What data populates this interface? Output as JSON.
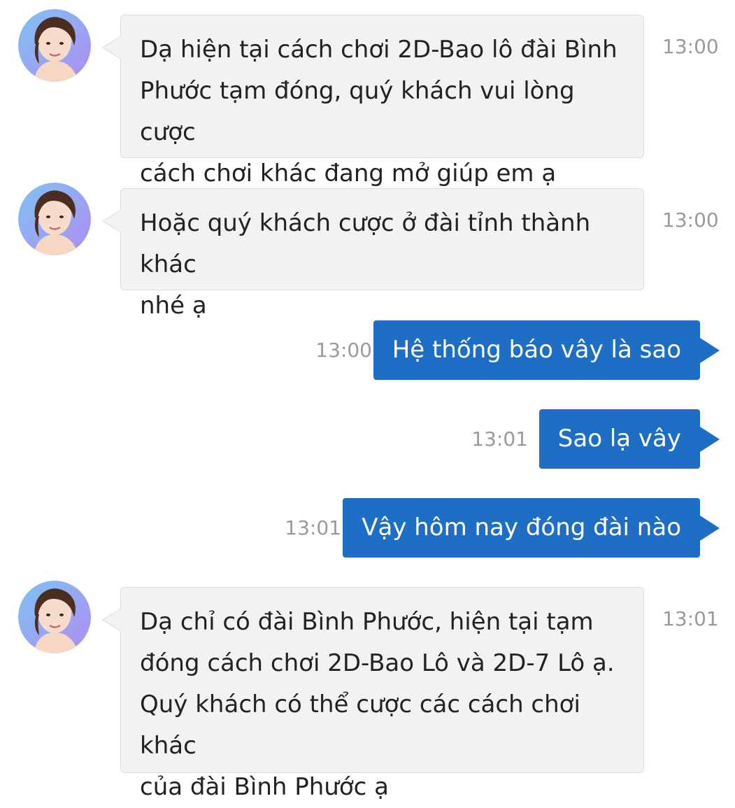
{
  "messages": [
    {
      "side": "incoming",
      "avatar": "female-agent-avatar",
      "lines": [
        "Dạ hiện tại cách chơi 2D-Bao lô đài Bình",
        "Phước tạm đóng, quý khách vui lòng cược",
        "cách chơi khác đang mở giúp em ạ"
      ],
      "time": "13:00"
    },
    {
      "side": "incoming",
      "avatar": "female-agent-avatar",
      "lines": [
        "Hoặc quý khách cược ở đài tỉnh thành khác",
        "nhé ạ"
      ],
      "time": "13:00"
    },
    {
      "side": "outgoing",
      "text": "Hệ thống báo vây là sao",
      "time": "13:00"
    },
    {
      "side": "outgoing",
      "text": "Sao lạ vây",
      "time": "13:01"
    },
    {
      "side": "outgoing",
      "text": "Vậy hôm nay đóng đài nào",
      "time": "13:01"
    },
    {
      "side": "incoming",
      "avatar": "female-agent-avatar",
      "lines": [
        "Dạ chỉ có đài Bình Phước, hiện tại tạm",
        "đóng cách chơi 2D-Bao Lô và 2D-7 Lô ạ.",
        "Quý khách có thể cược các cách chơi khác",
        "của đài Bình Phước ạ"
      ],
      "time": "13:01"
    }
  ],
  "colors": {
    "incoming_bubble": "#f2f2f2",
    "incoming_border": "#dcdcdc",
    "outgoing_bubble": "#1e6ec6",
    "timestamp": "#9a9a9a",
    "avatar_ring": "#a98cf0"
  }
}
